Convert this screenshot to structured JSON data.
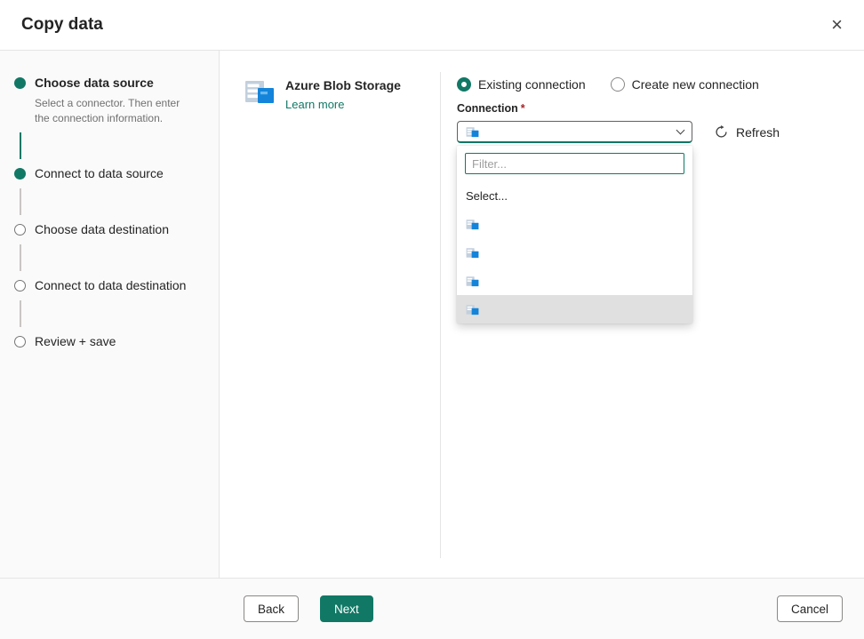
{
  "window": {
    "title": "Copy data"
  },
  "header": {
    "close_icon": "×"
  },
  "stepper": {
    "steps": [
      {
        "label": "Choose data source",
        "description": "Select a connector. Then enter the connection information.",
        "state": "complete",
        "current": true
      },
      {
        "label": "Connect to data source",
        "state": "complete",
        "current": false
      },
      {
        "label": "Choose data destination",
        "state": "pending",
        "current": false
      },
      {
        "label": "Connect to data destination",
        "state": "pending",
        "current": false
      },
      {
        "label": "Review + save",
        "state": "pending",
        "current": false
      }
    ]
  },
  "connector": {
    "name": "Azure Blob Storage",
    "learn_more_label": "Learn more",
    "icon": "azure-blob-storage-icon"
  },
  "form": {
    "radios": {
      "existing_label": "Existing connection",
      "create_label": "Create new connection",
      "selected": "existing"
    },
    "connection": {
      "label": "Connection",
      "required_marker": "*"
    },
    "refresh_label": "Refresh",
    "dropdown": {
      "filter_placeholder": "Filter...",
      "placeholder_option": "Select...",
      "options": [
        {
          "icon": "azure-blob-storage-icon",
          "label": ""
        },
        {
          "icon": "azure-blob-storage-icon",
          "label": ""
        },
        {
          "icon": "azure-blob-storage-icon",
          "label": ""
        },
        {
          "icon": "azure-blob-storage-icon",
          "label": ""
        }
      ],
      "highlighted_index": 3
    }
  },
  "footer": {
    "back_label": "Back",
    "next_label": "Next",
    "cancel_label": "Cancel"
  },
  "colors": {
    "accent": "#117865",
    "link": "#117865",
    "required": "#a4262c",
    "step_complete": "#117865",
    "highlight_row": "#e0e0e0",
    "blob_blue": "#1384da"
  }
}
